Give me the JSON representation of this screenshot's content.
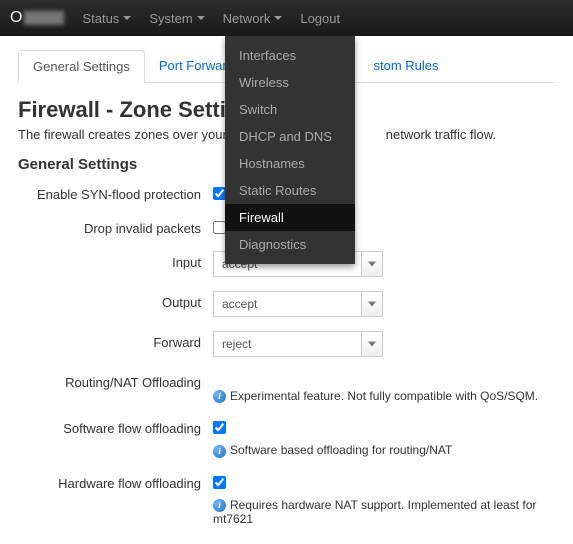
{
  "brand_letter": "O",
  "nav": {
    "status": "Status",
    "system": "System",
    "network": "Network",
    "logout": "Logout"
  },
  "network_menu": {
    "items": [
      {
        "label": "Interfaces"
      },
      {
        "label": "Wireless"
      },
      {
        "label": "Switch"
      },
      {
        "label": "DHCP and DNS"
      },
      {
        "label": "Hostnames"
      },
      {
        "label": "Static Routes"
      },
      {
        "label": "Firewall",
        "active": true
      },
      {
        "label": "Diagnostics"
      }
    ]
  },
  "tabs": {
    "general": "General Settings",
    "port_forwards": "Port Forwards",
    "custom_rules": "stom Rules"
  },
  "page": {
    "title": "Firewall - Zone Setting",
    "desc_a": "The firewall creates zones over your net",
    "desc_b": "network traffic flow."
  },
  "section": {
    "title": "General Settings"
  },
  "fields": {
    "syn_flood_label": "Enable SYN-flood protection",
    "drop_invalid_label": "Drop invalid packets",
    "input_label": "Input",
    "input_value": "accept",
    "output_label": "Output",
    "output_value": "accept",
    "forward_label": "Forward",
    "forward_value": "reject",
    "routing_label": "Routing/NAT Offloading",
    "routing_hint": "Experimental feature. Not fully compatible with QoS/SQM.",
    "soft_label": "Software flow offloading",
    "soft_hint": "Software based offloading for routing/NAT",
    "hard_label": "Hardware flow offloading",
    "hard_hint": "Requires hardware NAT support. Implemented at least for mt7621"
  }
}
